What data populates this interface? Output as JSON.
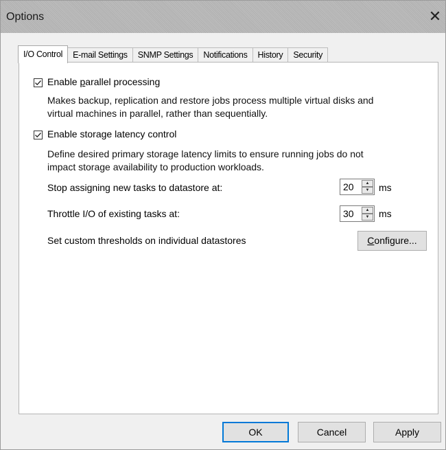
{
  "window": {
    "title": "Options",
    "close_glyph": "✕"
  },
  "tabs": [
    {
      "label": "I/O Control",
      "active": true
    },
    {
      "label": "E-mail Settings",
      "active": false
    },
    {
      "label": "SNMP Settings",
      "active": false
    },
    {
      "label": "Notifications",
      "active": false
    },
    {
      "label": "History",
      "active": false
    },
    {
      "label": "Security",
      "active": false
    }
  ],
  "io_control": {
    "parallel": {
      "checked": true,
      "label_prefix": "Enable ",
      "label_accel": "p",
      "label_suffix": "arallel processing",
      "description_line1": "Makes backup, replication and restore jobs process multiple virtual disks and",
      "description_line2": "virtual machines in parallel, rather than sequentially."
    },
    "latency": {
      "checked": true,
      "label": "Enable storage latency control",
      "description_line1": "Define desired primary storage latency limits to ensure running jobs do not",
      "description_line2": "impact storage availability to production workloads.",
      "stop_label": "Stop assigning new tasks to datastore at:",
      "stop_value": "20",
      "stop_unit": "ms",
      "throttle_label": "Throttle I/O of existing tasks at:",
      "throttle_value": "30",
      "throttle_unit": "ms",
      "custom_label": "Set custom thresholds on individual datastores",
      "configure_accel": "C",
      "configure_rest": "onfigure..."
    }
  },
  "footer": {
    "ok_label": "OK",
    "cancel_label": "Cancel",
    "apply_label": "Apply"
  },
  "colors": {
    "title_bar": "#b8b8b8",
    "dialog_bg": "#f0f0f0",
    "panel_bg": "#ffffff",
    "default_button_border": "#0078d7"
  }
}
